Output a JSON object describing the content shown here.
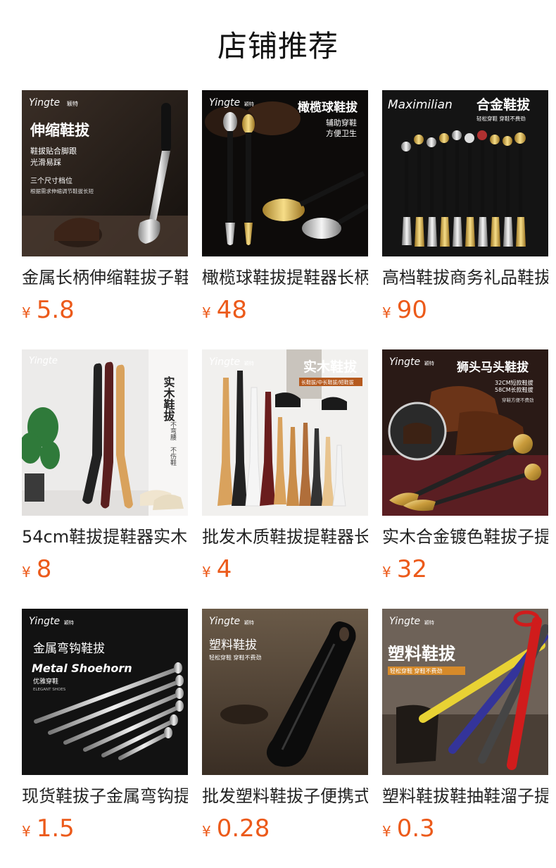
{
  "header": {
    "title": "店铺推荐"
  },
  "currency_symbol": "¥",
  "products": [
    {
      "name": "金属长柄伸缩鞋拔子鞋",
      "price": "5.8",
      "image": {
        "brand": "Yingte",
        "brand_cn": "颖特",
        "title": "伸缩鞋拔",
        "lines": [
          "鞋拔贴合脚跟",
          "光滑易踩",
          "三个尺寸档位",
          "根据需求伸缩调节鞋拔长短"
        ]
      }
    },
    {
      "name": "橄榄球鞋拔提鞋器长柄",
      "price": "48",
      "image": {
        "brand": "Yingte",
        "brand_cn": "颖特",
        "title": "橄榄球鞋拔",
        "lines": [
          "辅助穿鞋",
          "方便卫生"
        ]
      }
    },
    {
      "name": "高档鞋拔商务礼品鞋拔",
      "price": "90",
      "image": {
        "brand": "Maximilian",
        "title": "合金鞋拔",
        "lines": [
          "轻松穿鞋 穿鞋不费劲"
        ]
      }
    },
    {
      "name": "54cm鞋拔提鞋器实木",
      "price": "8",
      "image": {
        "brand": "Yingte",
        "brand_cn": "颖特",
        "title": "实木鞋拔",
        "lines": [
          "不弯腰",
          "不伤鞋"
        ]
      }
    },
    {
      "name": "批发木质鞋拔提鞋器长",
      "price": "4",
      "image": {
        "brand": "Yingte",
        "brand_cn": "颖特",
        "title": "实木鞋拔",
        "lines": [
          "长鞋拔/中长鞋拔/短鞋拔"
        ]
      }
    },
    {
      "name": "实木合金镀色鞋拔子提",
      "price": "32",
      "image": {
        "brand": "Yingte",
        "brand_cn": "颖特",
        "title": "狮头马头鞋拔",
        "lines": [
          "32CM短款鞋拔",
          "58CM长款鞋拔",
          "穿鞋方便不费劲"
        ]
      }
    },
    {
      "name": "现货鞋拔子金属弯钩提",
      "price": "1.5",
      "image": {
        "brand": "Yingte",
        "brand_cn": "颖特",
        "title": "金属弯钩鞋拔",
        "subtitle": "Metal Shoehorn",
        "lines": [
          "优雅穿鞋",
          "ELEGANT SHOES"
        ]
      }
    },
    {
      "name": "批发塑料鞋拔子便携式",
      "price": "0.28",
      "image": {
        "brand": "Yingte",
        "brand_cn": "颖特",
        "title": "塑料鞋拔",
        "lines": [
          "轻松穿鞋 穿鞋不费劲"
        ]
      }
    },
    {
      "name": "塑料鞋拔鞋抽鞋溜子提",
      "price": "0.3",
      "image": {
        "brand": "Yingte",
        "brand_cn": "颖特",
        "title": "塑料鞋拔",
        "lines": [
          "轻松穿鞋 穿鞋不费劲"
        ]
      }
    }
  ]
}
